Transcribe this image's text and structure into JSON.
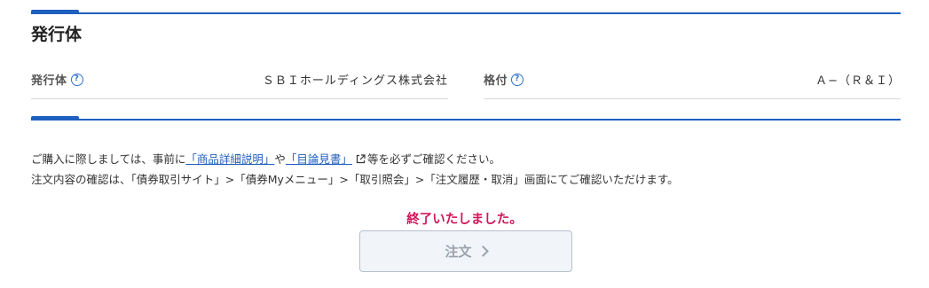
{
  "section": {
    "title": "発行体"
  },
  "info": {
    "issuer_label": "発行体",
    "issuer_value": "ＳＢＩホールディングス株式会社",
    "rating_label": "格付",
    "rating_value": "Ａ−（Ｒ＆Ｉ）",
    "help_icon_glyph": "?"
  },
  "notice": {
    "line1_prefix": "ご購入に際しましては、事前に",
    "link_product": "「商品詳細説明」",
    "line1_middle": "や",
    "link_prospectus": "「目論見書」",
    "line1_suffix": "等を必ずご確認ください。",
    "line2": "注文内容の確認は、「債券取引サイト」>「債券Myメニュー」>「取引照会」>「注文履歴・取消」画面にてご確認いただけます。"
  },
  "status": {
    "completed_message": "終了いたしました。"
  },
  "order": {
    "button_label": "注文"
  },
  "colors": {
    "accent_blue": "#1f5fbf",
    "alert_magenta": "#d1175a",
    "disabled_text": "#9aa3ad"
  }
}
